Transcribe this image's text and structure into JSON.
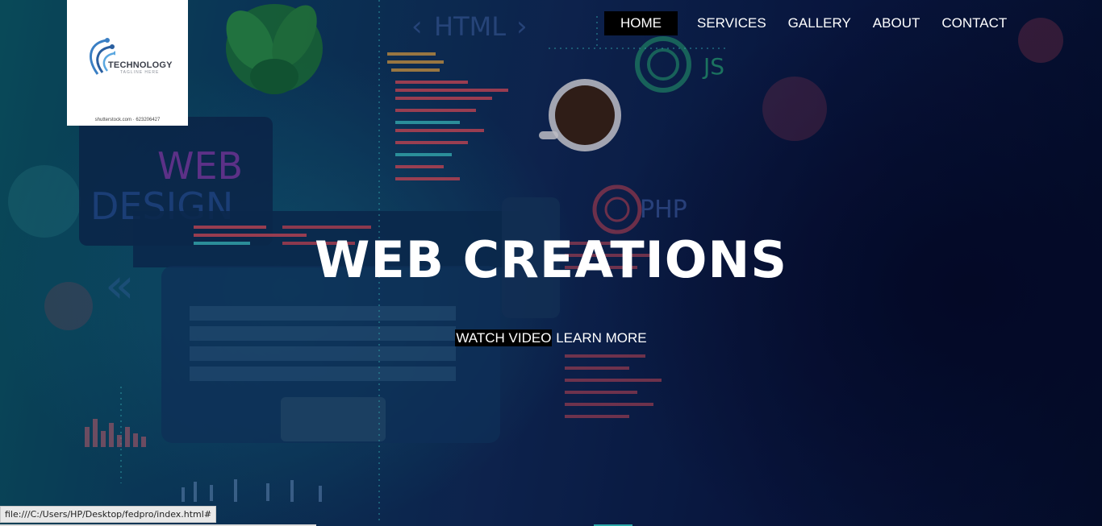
{
  "logo": {
    "name": "TECHNOLOGY",
    "tagline": "TAGLINE HERE",
    "credit": "shutterstock.com · 623206427"
  },
  "nav": {
    "items": [
      {
        "label": "HOME",
        "active": true
      },
      {
        "label": "SERVICES",
        "active": false
      },
      {
        "label": "GALLERY",
        "active": false
      },
      {
        "label": "ABOUT",
        "active": false
      },
      {
        "label": "CONTACT",
        "active": false
      }
    ]
  },
  "hero": {
    "title": "WEB CREATIONS",
    "watch_label": "WATCH VIDEO",
    "learn_label": "LEARN MORE"
  },
  "background": {
    "labels": {
      "html": "HTML",
      "js": "JS",
      "php": "PHP",
      "web": "WEB",
      "design": "DESIGN"
    }
  },
  "status": {
    "url": "file:///C:/Users/HP/Desktop/fedpro/index.html#"
  },
  "colors": {
    "nav_active_bg": "#000000",
    "text": "#ffffff",
    "status_bg": "#e9e9e9"
  }
}
